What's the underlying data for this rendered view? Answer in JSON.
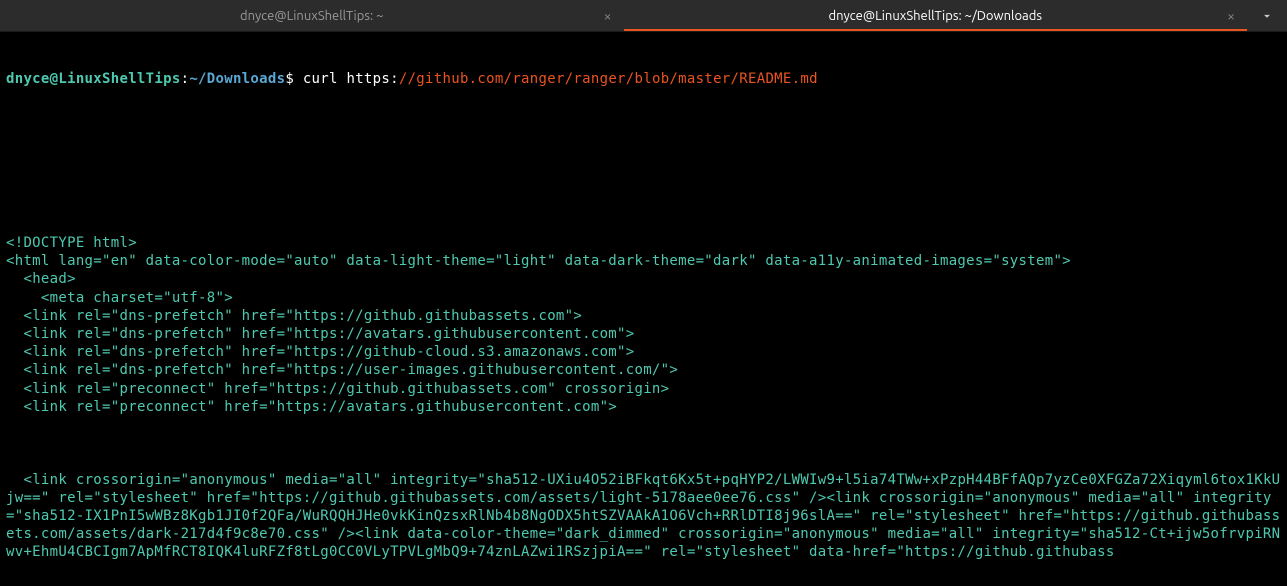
{
  "tabs": [
    {
      "title": "dnyce@LinuxShellTips: ~",
      "active": false
    },
    {
      "title": "dnyce@LinuxShellTips: ~/Downloads",
      "active": true
    }
  ],
  "prompt": {
    "user_host": "dnyce@LinuxShellTips",
    "colon": ":",
    "path": "~/Downloads",
    "dollar": "$"
  },
  "command": {
    "name": "curl",
    "url_scheme": "https:",
    "url_rest": "//github.com/ranger/ranger/blob/master/README.md"
  },
  "output_lines": [
    "",
    "",
    "",
    "",
    "",
    "",
    "<!DOCTYPE html>",
    "<html lang=\"en\" data-color-mode=\"auto\" data-light-theme=\"light\" data-dark-theme=\"dark\" data-a11y-animated-images=\"system\">",
    "  <head>",
    "    <meta charset=\"utf-8\">",
    "  <link rel=\"dns-prefetch\" href=\"https://github.githubassets.com\">",
    "  <link rel=\"dns-prefetch\" href=\"https://avatars.githubusercontent.com\">",
    "  <link rel=\"dns-prefetch\" href=\"https://github-cloud.s3.amazonaws.com\">",
    "  <link rel=\"dns-prefetch\" href=\"https://user-images.githubusercontent.com/\">",
    "  <link rel=\"preconnect\" href=\"https://github.githubassets.com\" crossorigin>",
    "  <link rel=\"preconnect\" href=\"https://avatars.githubusercontent.com\">",
    "",
    "",
    "",
    "  <link crossorigin=\"anonymous\" media=\"all\" integrity=\"sha512-UXiu4O52iBFkqt6Kx5t+pqHYP2/LWWIw9+l5ia74TWw+xPzpH44BFfAQp7yzCe0XFGZa72Xiqyml6tox1KkUjw==\" rel=\"stylesheet\" href=\"https://github.githubassets.com/assets/light-5178aee0ee76.css\" /><link crossorigin=\"anonymous\" media=\"all\" integrity=\"sha512-IX1PnI5wWBz8Kgb1JI0f2QFa/WuRQQHJHe0vkKinQzsxRlNb4b8NgODX5htSZVAAkA1O6Vch+RRlDTI8j96slA==\" rel=\"stylesheet\" href=\"https://github.githubassets.com/assets/dark-217d4f9c8e70.css\" /><link data-color-theme=\"dark_dimmed\" crossorigin=\"anonymous\" media=\"all\" integrity=\"sha512-Ct+ijw5ofrvpiRNwv+EhmU4CBCIgm7ApMfRCT8IQK4luRFZf8tLg0CC0VLyTPVLgMbQ9+74znLAZwi1RSzjpiA==\" rel=\"stylesheet\" data-href=\"https://github.githubass"
  ]
}
